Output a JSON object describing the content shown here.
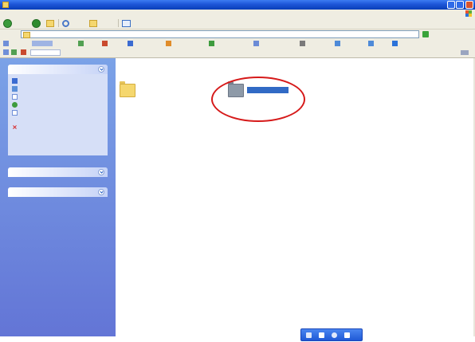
{
  "window": {
    "title": "",
    "app_icon": "folder-icon",
    "controls": [
      "minimize-icon",
      "maximize-icon",
      "close-icon"
    ],
    "title_gradient": [
      "#3d7cf2",
      "#0a3fb8"
    ]
  },
  "menu": {
    "items": [
      "",
      "",
      "",
      "",
      "",
      ""
    ],
    "logo": "windows-logo-icon"
  },
  "toolbar": {
    "back_label": "",
    "search_label": "",
    "folders_label": "",
    "icons": [
      "back-icon",
      "forward-icon",
      "up-folder-icon",
      "search-icon",
      "folders-icon",
      "views-icon"
    ]
  },
  "address": {
    "label": "",
    "value": "",
    "go_label": "",
    "links_label": ""
  },
  "task_pane": {
    "background": "#6f8ee0",
    "panels": [
      {
        "title": "",
        "tasks": [
          {
            "label": "",
            "icon": "move-icon"
          },
          {
            "label": "",
            "icon": "copy-icon"
          },
          {
            "label": "",
            "icon": "rename-icon"
          },
          {
            "label": "",
            "icon": "publish-icon"
          },
          {
            "label": "",
            "icon": "email-icon"
          },
          {
            "label": "",
            "icon": "delete-icon"
          }
        ]
      },
      {
        "title": "",
        "tasks": []
      },
      {
        "title": "",
        "tasks": []
      }
    ]
  },
  "files": [
    {
      "name": "",
      "icon": "folder-icon",
      "color": "#f5d76e",
      "selected": false
    },
    {
      "name": "",
      "icon": "folder-icon",
      "color": "#8e9aa8",
      "selected": true
    }
  ],
  "annotation": {
    "shape": "ellipse",
    "color": "#d61a1a",
    "target": "selected-folder"
  },
  "taskbar": {
    "icons": [
      "keyboard-icon",
      "pen-icon",
      "help-icon",
      "settings-icon"
    ]
  }
}
